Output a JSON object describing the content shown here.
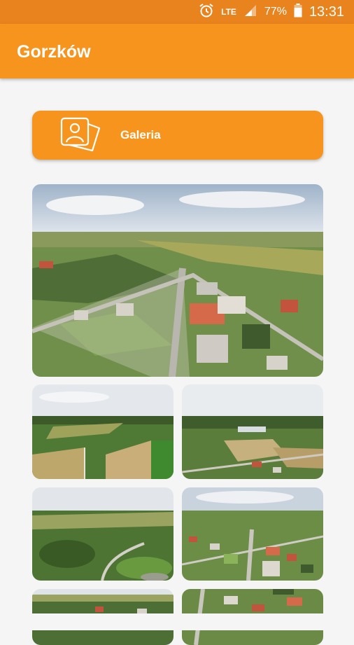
{
  "status_bar": {
    "network": "LTE",
    "battery": "77%",
    "time": "13:31"
  },
  "app_bar": {
    "title": "Gorzków"
  },
  "gallery_button": {
    "label": "Galeria",
    "icon": "gallery-photos-icon"
  },
  "photos": [
    {
      "name": "aerial-town-square-photo"
    },
    {
      "name": "aerial-fields-photo"
    },
    {
      "name": "aerial-valley-photo"
    },
    {
      "name": "aerial-road-trees-photo"
    },
    {
      "name": "aerial-village-photo"
    },
    {
      "name": "aerial-partial-photo-left"
    },
    {
      "name": "aerial-partial-photo-right"
    }
  ]
}
